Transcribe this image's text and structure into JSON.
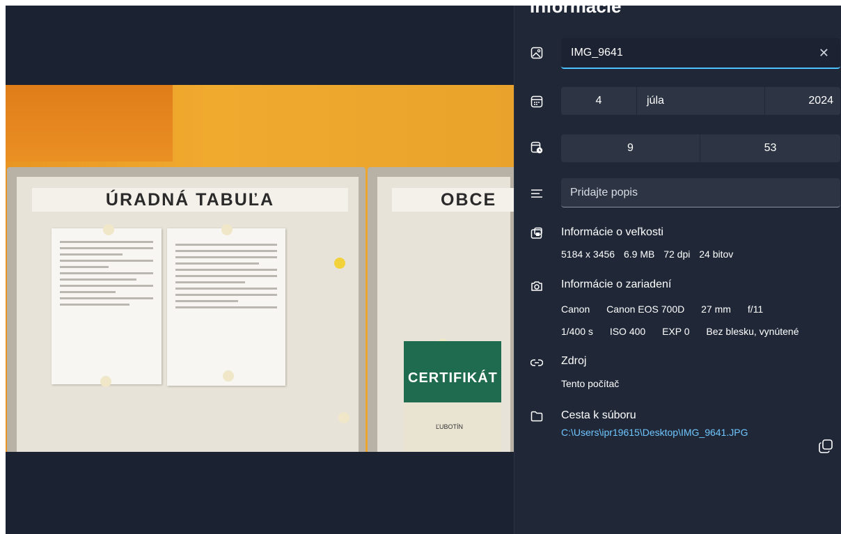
{
  "photo": {
    "board_left_heading": "ÚRADNÁ TABUĽA",
    "board_right_heading": "OBCE",
    "certificate_title": "CERTIFIKÁT",
    "certificate_town": "ĽUBOTÍN"
  },
  "panel": {
    "title": "Informácie",
    "file_name": {
      "value": "IMG_9641",
      "clear_icon": "close-icon"
    },
    "date": {
      "day": "4",
      "month": "júla",
      "year": "2024",
      "icon": "calendar-icon"
    },
    "time": {
      "hour": "9",
      "minute": "53",
      "icon": "clock-icon"
    },
    "description": {
      "placeholder": "Pridajte popis",
      "icon": "text-lines-icon"
    },
    "size_info": {
      "title": "Informácie o veľkosti",
      "dimensions": "5184 x 3456",
      "file_size": "6.9 MB",
      "dpi": "72 dpi",
      "bit_depth": "24 bitov",
      "icon": "image-size-icon"
    },
    "device_info": {
      "title": "Informácie o zariadení",
      "make": "Canon",
      "model": "Canon EOS 700D",
      "focal_length": "27 mm",
      "aperture": "f/11",
      "exposure": "1/400 s",
      "iso": "ISO 400",
      "exp_bias": "EXP 0",
      "flash": "Bez blesku, vynútené",
      "icon": "camera-icon"
    },
    "source": {
      "title": "Zdroj",
      "value": "Tento počítač",
      "icon": "link-icon"
    },
    "file_path": {
      "title": "Cesta k súboru",
      "value": "C:\\Users\\ipr19615\\Desktop\\IMG_9641.JPG",
      "icon": "folder-icon",
      "copy_icon": "copy-icon"
    }
  },
  "colors": {
    "panel_bg": "#202838",
    "accent": "#4cc2ff",
    "link": "#6fc6ff",
    "viewer_bg": "#1b2333"
  }
}
